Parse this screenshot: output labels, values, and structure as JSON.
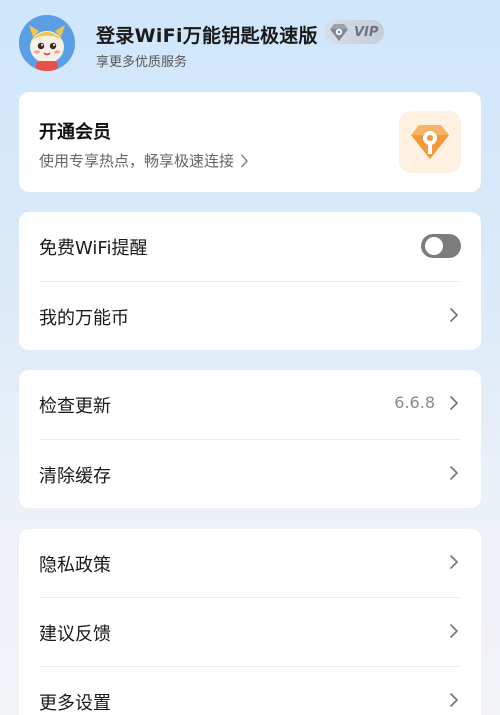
{
  "header": {
    "title": "登录WiFi万能钥匙极速版",
    "vip_label": "VIP",
    "subtitle": "享更多优质服务",
    "avatar_icon": "cartoon-dragon-avatar"
  },
  "member_card": {
    "title": "开通会员",
    "subtitle": "使用专享热点，畅享极速连接",
    "icon": "vip-key-diamond-icon"
  },
  "group1": {
    "items": [
      {
        "label": "免费WiFi提醒",
        "type": "toggle",
        "toggle_on": false
      },
      {
        "label": "我的万能币",
        "type": "link"
      }
    ]
  },
  "group2": {
    "items": [
      {
        "label": "检查更新",
        "value": "6.6.8"
      },
      {
        "label": "清除缓存"
      }
    ]
  },
  "group3": {
    "items": [
      {
        "label": "隐私政策"
      },
      {
        "label": "建议反馈"
      },
      {
        "label": "更多设置"
      }
    ]
  },
  "colors": {
    "bg_top": "#cfe6fb",
    "bg_bottom": "#f1f3f7",
    "card": "#ffffff",
    "toggle_off": "#7c7c7c",
    "vip_badge": "#c5ccd8",
    "member_icon_bg": "#fff1e2",
    "member_icon_accent": "#f29a3a"
  }
}
